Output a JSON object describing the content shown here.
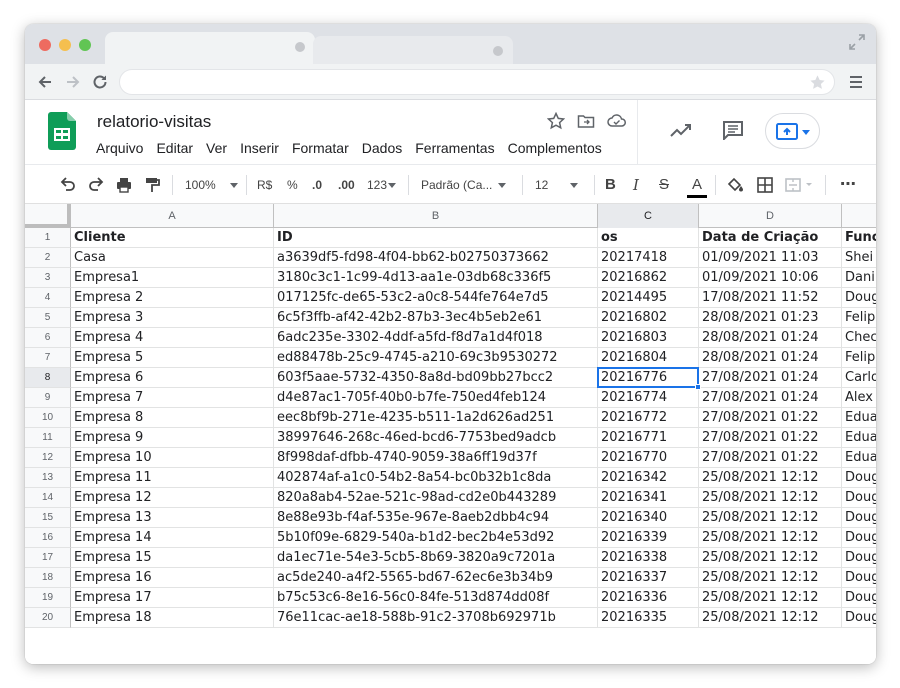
{
  "doc": {
    "title": "relatorio-visitas",
    "menu": [
      "Arquivo",
      "Editar",
      "Ver",
      "Inserir",
      "Formatar",
      "Dados",
      "Ferramentas",
      "Complementos"
    ]
  },
  "toolbar": {
    "zoom": "100%",
    "currency": "R$",
    "percent": "%",
    "dec_decrease": ".0",
    "dec_increase": ".00",
    "more_formats": "123",
    "font": "Padrão (Ca...",
    "font_size": "12"
  },
  "columns": [
    "A",
    "B",
    "C",
    "D"
  ],
  "selected_column": "C",
  "selected_row": "8",
  "header_row": [
    "Cliente",
    "ID",
    "os",
    "Data de Criação",
    "Func"
  ],
  "rows": [
    {
      "n": "2",
      "cells": [
        "Casa",
        "a3639df5-fd98-4f04-bb62-b02750373662",
        "20217418",
        "01/09/2021 11:03",
        "Shei"
      ]
    },
    {
      "n": "3",
      "cells": [
        "Empresa1",
        "3180c3c1-1c99-4d13-aa1e-03db68c336f5",
        "20216862",
        "01/09/2021 10:06",
        "Dani"
      ]
    },
    {
      "n": "4",
      "cells": [
        "Empresa 2",
        "017125fc-de65-53c2-a0c8-544fe764e7d5",
        "20214495",
        "17/08/2021 11:52",
        "Doug"
      ]
    },
    {
      "n": "5",
      "cells": [
        "Empresa 3",
        "6c5f3ffb-af42-42b2-87b3-3ec4b5eb2e61",
        "20216802",
        "28/08/2021 01:23",
        "Felip"
      ]
    },
    {
      "n": "6",
      "cells": [
        "Empresa 4",
        "6adc235e-3302-4ddf-a5fd-f8d7a1d4f018",
        "20216803",
        "28/08/2021 01:24",
        "Chec"
      ]
    },
    {
      "n": "7",
      "cells": [
        "Empresa 5",
        "ed88478b-25c9-4745-a210-69c3b9530272",
        "20216804",
        "28/08/2021 01:24",
        "Felip"
      ]
    },
    {
      "n": "8",
      "cells": [
        "Empresa 6",
        "603f5aae-5732-4350-8a8d-bd09bb27bcc2",
        "20216776",
        "27/08/2021 01:24",
        "Carlo"
      ]
    },
    {
      "n": "9",
      "cells": [
        "Empresa 7",
        "d4e87ac1-705f-40b0-b7fe-750ed4feb124",
        "20216774",
        "27/08/2021 01:24",
        "Alex"
      ]
    },
    {
      "n": "10",
      "cells": [
        "Empresa 8",
        "eec8bf9b-271e-4235-b511-1a2d626ad251",
        "20216772",
        "27/08/2021 01:22",
        "Edua"
      ]
    },
    {
      "n": "11",
      "cells": [
        "Empresa 9",
        "38997646-268c-46ed-bcd6-7753bed9adcb",
        "20216771",
        "27/08/2021 01:22",
        "Edua"
      ]
    },
    {
      "n": "12",
      "cells": [
        "Empresa 10",
        "8f998daf-dfbb-4740-9059-38a6ff19d37f",
        "20216770",
        "27/08/2021 01:22",
        "Edua"
      ]
    },
    {
      "n": "13",
      "cells": [
        "Empresa 11",
        "402874af-a1c0-54b2-8a54-bc0b32b1c8da",
        "20216342",
        "25/08/2021 12:12",
        "Doug"
      ]
    },
    {
      "n": "14",
      "cells": [
        "Empresa 12",
        "820a8ab4-52ae-521c-98ad-cd2e0b443289",
        "20216341",
        "25/08/2021 12:12",
        "Doug"
      ]
    },
    {
      "n": "15",
      "cells": [
        "Empresa 13",
        "8e88e93b-f4af-535e-967e-8aeb2dbb4c94",
        "20216340",
        "25/08/2021 12:12",
        "Doug"
      ]
    },
    {
      "n": "16",
      "cells": [
        "Empresa 14",
        "5b10f09e-6829-540a-b1d2-bec2b4e53d92",
        "20216339",
        "25/08/2021 12:12",
        "Doug"
      ]
    },
    {
      "n": "17",
      "cells": [
        "Empresa 15",
        "da1ec71e-54e3-5cb5-8b69-3820a9c7201a",
        "20216338",
        "25/08/2021 12:12",
        "Doug"
      ]
    },
    {
      "n": "18",
      "cells": [
        "Empresa 16",
        "ac5de240-a4f2-5565-bd67-62ec6e3b34b9",
        "20216337",
        "25/08/2021 12:12",
        "Doug"
      ]
    },
    {
      "n": "19",
      "cells": [
        "Empresa 17",
        "b75c53c6-8e16-56c0-84fe-513d874dd08f",
        "20216336",
        "25/08/2021 12:12",
        "Doug"
      ]
    },
    {
      "n": "20",
      "cells": [
        "Empresa 18",
        "76e11cac-ae18-588b-91c2-3708b692971b",
        "20216335",
        "25/08/2021 12:12",
        "Doug"
      ]
    }
  ],
  "icons": {
    "logo": "google-sheets-logo-icon",
    "accent": "#1a73e8",
    "sheets_green": "#0f9d58"
  }
}
